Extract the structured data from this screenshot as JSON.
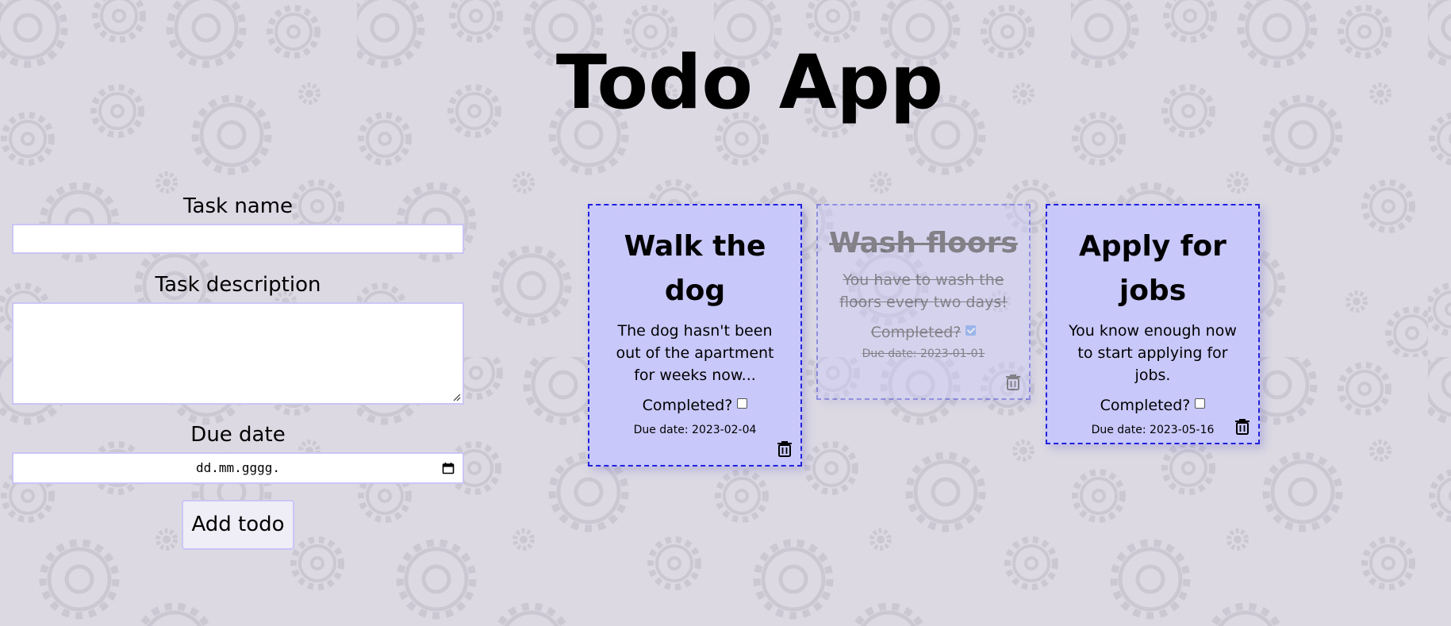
{
  "header": {
    "title": "Todo App"
  },
  "form": {
    "task_name_label": "Task name",
    "task_name_value": "",
    "task_description_label": "Task description",
    "task_description_value": "",
    "due_date_label": "Due date",
    "due_date_placeholder": "dd.mm.gggg.",
    "add_button_label": "Add todo",
    "date_icon": "calendar-icon"
  },
  "todos": [
    {
      "title": "Walk the dog",
      "description": "The dog hasn't been out of the apartment for weeks now...",
      "completed_label": "Completed?",
      "completed": false,
      "due_label": "Due date:",
      "due_date": "2023-02-04",
      "delete_icon": "trash-icon"
    },
    {
      "title": "Wash floors",
      "description": "You have to wash the floors every two days!",
      "completed_label": "Completed?",
      "completed": true,
      "due_label": "Due date:",
      "due_date": "2023-01-01",
      "delete_icon": "trash-icon"
    },
    {
      "title": "Apply for jobs",
      "description": "You know enough now to start applying for jobs.",
      "completed_label": "Completed?",
      "completed": false,
      "due_label": "Due date:",
      "due_date": "2023-05-16",
      "delete_icon": "trash-icon"
    }
  ],
  "colors": {
    "background": "#dcd9e3",
    "card_background": "#c9c8fb",
    "card_border": "#2222dd",
    "input_border": "#c9c6f5",
    "gear_pattern": "#cbc8d3"
  }
}
